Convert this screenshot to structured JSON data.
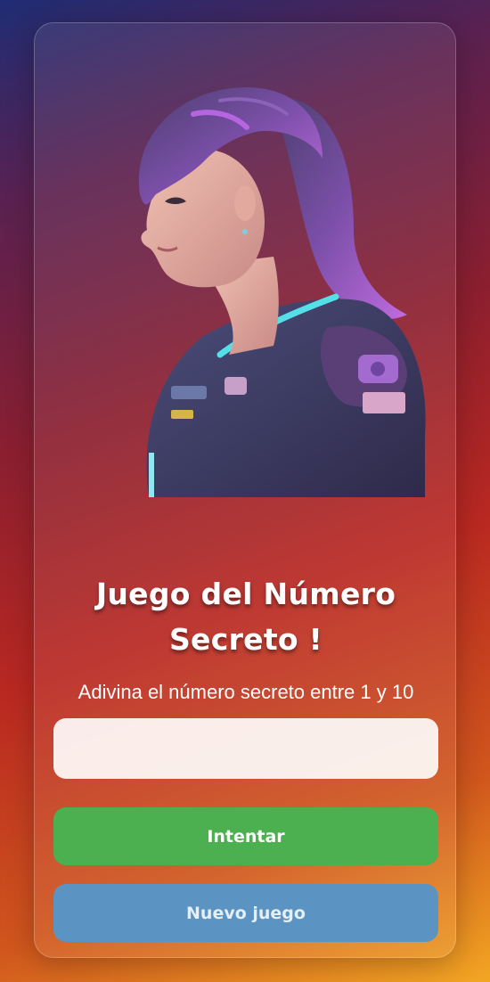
{
  "game": {
    "title": "Juego del Número Secreto !",
    "subtitle": "Adivina el número secreto entre 1 y 10"
  },
  "guess_input": {
    "value": "",
    "placeholder": ""
  },
  "buttons": {
    "try_label": "Intentar",
    "new_game_label": "Nuevo juego"
  },
  "colors": {
    "try_button": "#4caf50",
    "new_game_button": "#5b93c2"
  }
}
